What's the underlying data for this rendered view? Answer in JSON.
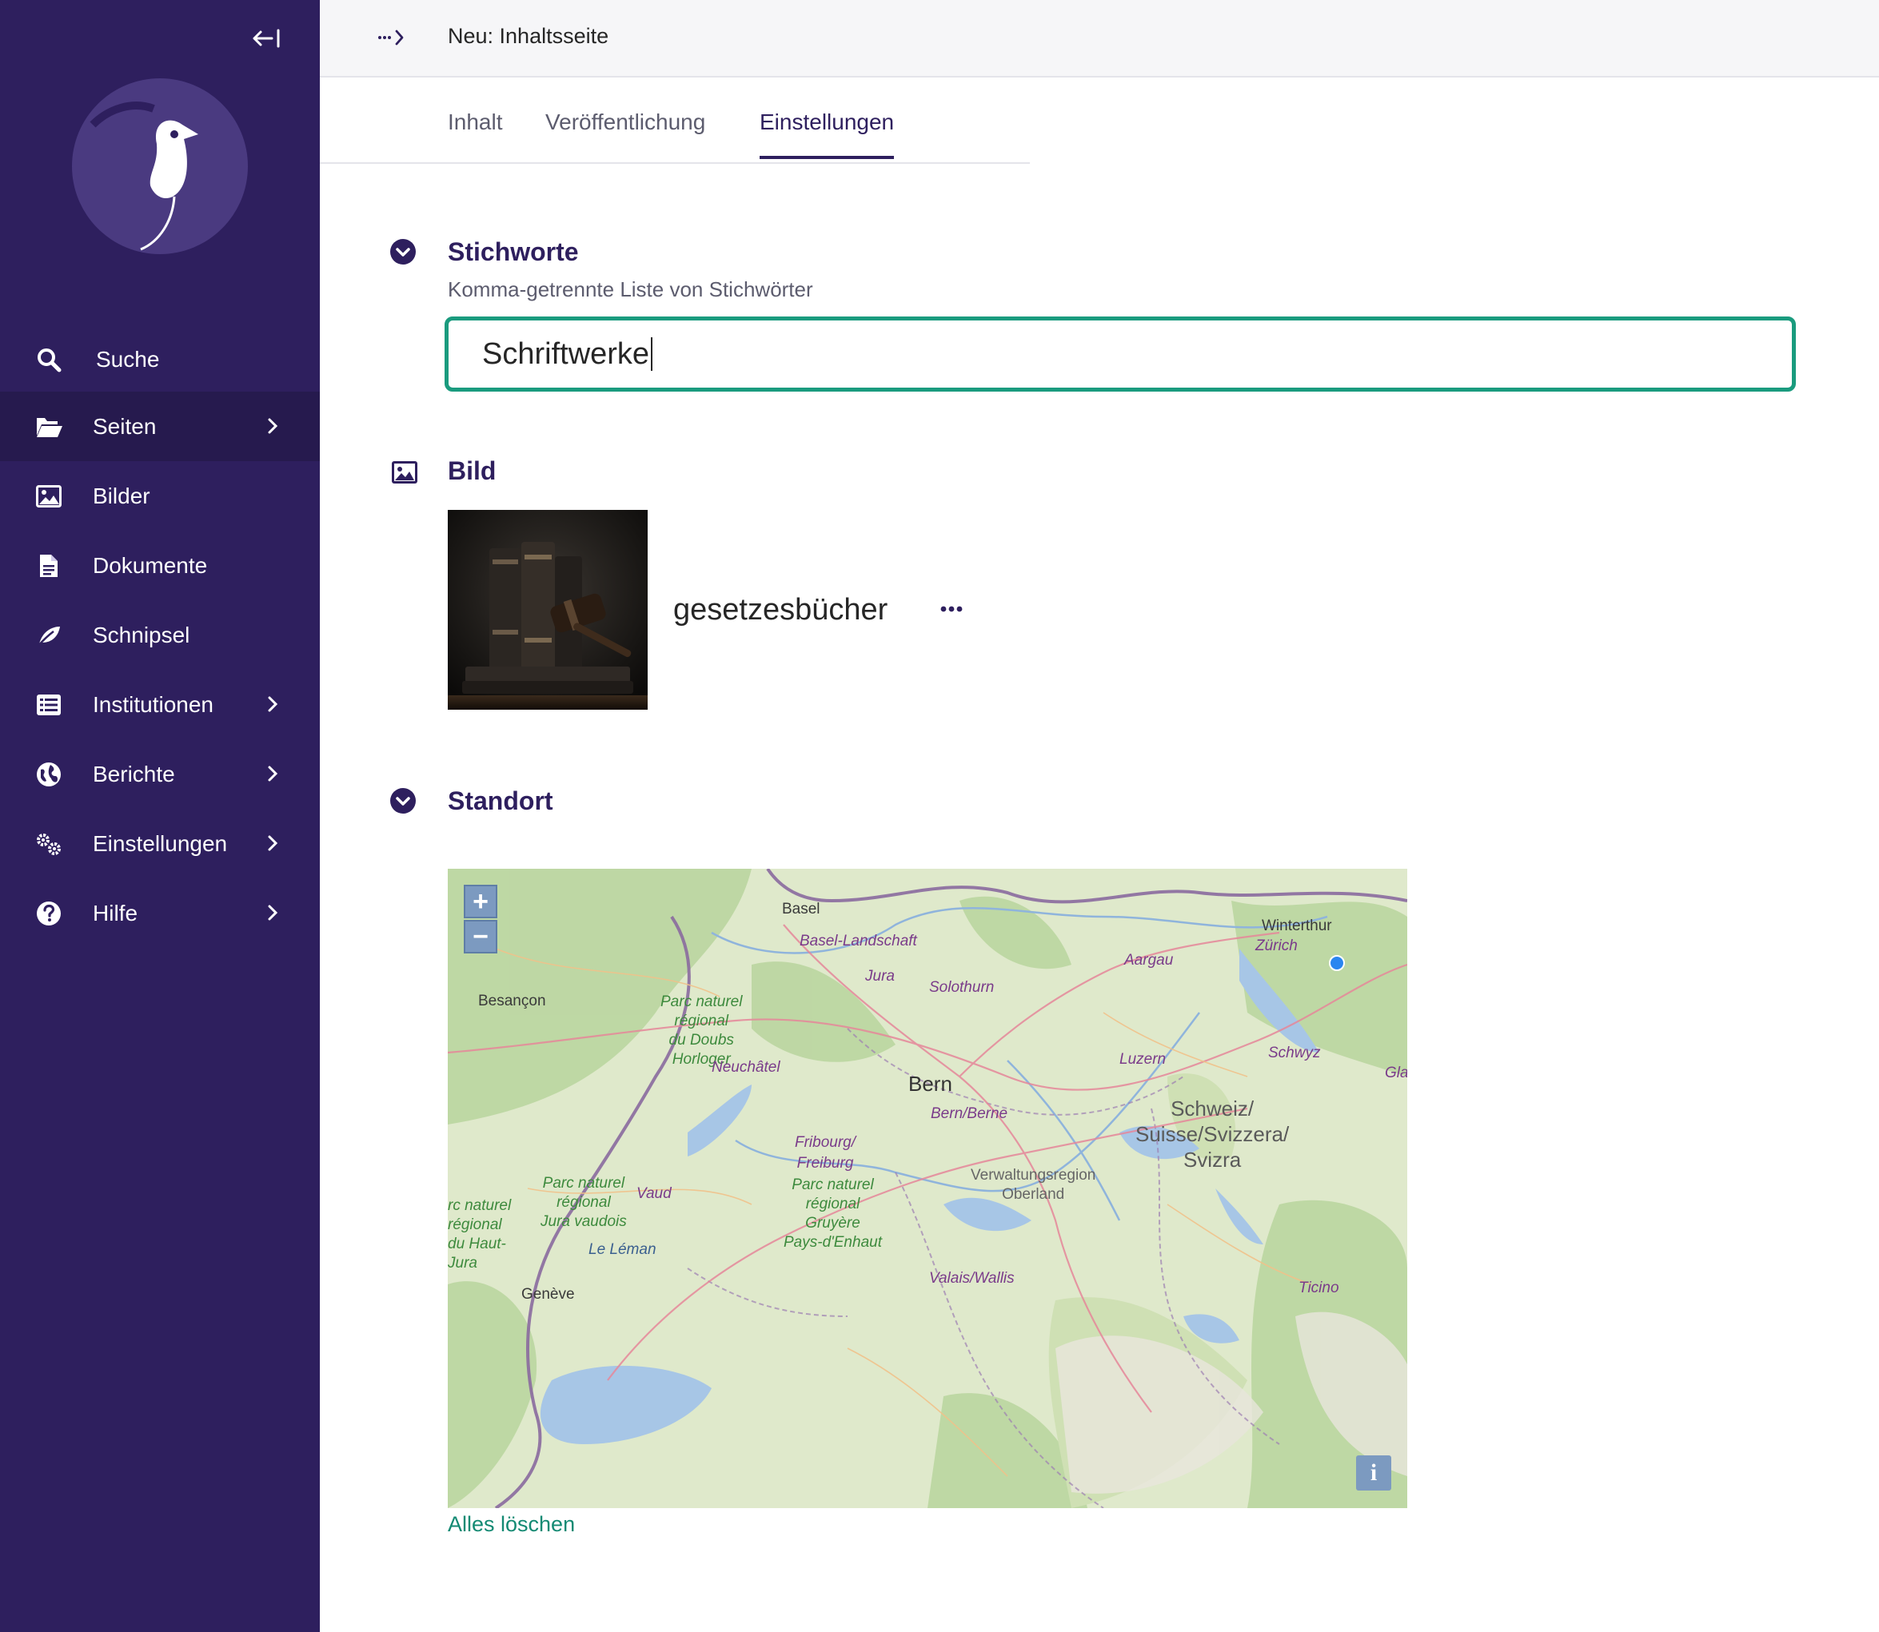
{
  "sidebar": {
    "items": [
      {
        "label": "Suche",
        "icon": "search-icon",
        "has_submenu": false,
        "active": false
      },
      {
        "label": "Seiten",
        "icon": "folder-open-icon",
        "has_submenu": true,
        "active": true
      },
      {
        "label": "Bilder",
        "icon": "image-icon",
        "has_submenu": false,
        "active": false
      },
      {
        "label": "Dokumente",
        "icon": "document-icon",
        "has_submenu": false,
        "active": false
      },
      {
        "label": "Schnipsel",
        "icon": "snippet-icon",
        "has_submenu": false,
        "active": false
      },
      {
        "label": "Institutionen",
        "icon": "list-icon",
        "has_submenu": true,
        "active": false
      },
      {
        "label": "Berichte",
        "icon": "globe-icon",
        "has_submenu": true,
        "active": false
      },
      {
        "label": "Einstellungen",
        "icon": "cogs-icon",
        "has_submenu": true,
        "active": false
      },
      {
        "label": "Hilfe",
        "icon": "help-icon",
        "has_submenu": true,
        "active": false
      }
    ]
  },
  "header": {
    "title": "Neu: Inhaltsseite"
  },
  "tabs": [
    {
      "label": "Inhalt",
      "active": false
    },
    {
      "label": "Veröffentlichung",
      "active": false
    },
    {
      "label": "Einstellungen",
      "active": true
    }
  ],
  "tags_section": {
    "title": "Stichworte",
    "help": "Komma-getrennte Liste von Stichwörter",
    "value": "Schriftwerke"
  },
  "image_section": {
    "title": "Bild",
    "image_name": "gesetzesbücher"
  },
  "location_section": {
    "title": "Standort",
    "map_labels": {
      "basel": "Basel",
      "basel_land": "Basel-Landschaft",
      "winterthur": "Winterthur",
      "zurich": "Zürich",
      "aargau": "Aargau",
      "jura": "Jura",
      "solothurn": "Solothurn",
      "besancon": "Besançon",
      "park_doubs": "Parc naturel\nrégional\ndu Doubs\nHorloger",
      "neuchatel": "Neuchâtel",
      "luzern": "Luzern",
      "schwyz": "Schwyz",
      "glarus": "Gla",
      "bern": "Bern",
      "bern_berne": "Bern/Berne",
      "schweiz": "Schweiz/\nSuisse/Svizzera/\nSvizra",
      "fribourg": "Fribourg/\nFreiburg",
      "park_jura_vaudois": "Parc naturel\nrégional\nJura vaudois",
      "vaud": "Vaud",
      "park_haut_jura": "rc naturel\nrégional\ndu Haut-\nJura",
      "park_gruyere": "Parc naturel\nrégional\nGruyère\nPays-d'Enhaut",
      "oberland": "Verwaltungsregion\nOberland",
      "le_leman": "Le Léman",
      "geneve": "Genève",
      "valais": "Valais/Wallis",
      "ticino": "Ticino"
    },
    "zoom_in": "+",
    "zoom_out": "−",
    "info": "i",
    "clear_label": "Alles löschen"
  },
  "colors": {
    "sidebar_bg": "#2e1f5e",
    "sidebar_active": "#261a4e",
    "accent_teal": "#1a9b7e",
    "link_teal": "#138a73",
    "primary_text": "#2e1f5e"
  }
}
